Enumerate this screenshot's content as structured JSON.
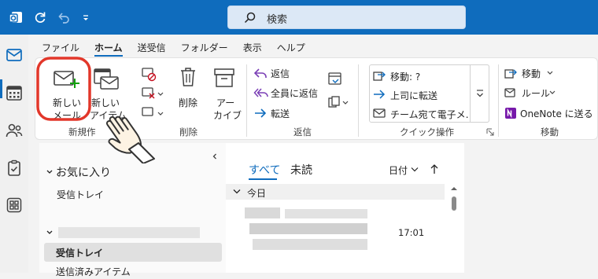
{
  "search": {
    "placeholder": "検索"
  },
  "tabs": [
    "ファイル",
    "ホーム",
    "送受信",
    "フォルダー",
    "表示",
    "ヘルプ"
  ],
  "ribbon": {
    "new_mail": [
      "新しい",
      "メール"
    ],
    "new_item": [
      "新しい",
      "アイテム"
    ],
    "delete": "削除",
    "archive": [
      "アー",
      "カイブ"
    ],
    "reply": "返信",
    "reply_all": "全員に返信",
    "forward": "転送",
    "quick_steps": [
      "移動: ?",
      "上司に転送",
      "チーム宛て電子メ…"
    ],
    "move": "移動",
    "rules": "ルール",
    "onenote": "OneNote に送る",
    "groups": {
      "new": "新規作",
      "delete": "削除",
      "respond": "返信",
      "quick_steps": "クイック操作",
      "move": "移動"
    }
  },
  "folders": {
    "favorites": "お気に入り",
    "inbox_fav": "受信トレイ",
    "inbox": "受信トレイ",
    "sent": "送信済みアイテム"
  },
  "messages": {
    "tab_all": "すべて",
    "tab_unread": "未読",
    "sort": "日付",
    "group_today": "今日",
    "time": "17:01"
  },
  "colors": {
    "accent": "#0f6cbd",
    "hand_highlight": "#e2372a"
  }
}
